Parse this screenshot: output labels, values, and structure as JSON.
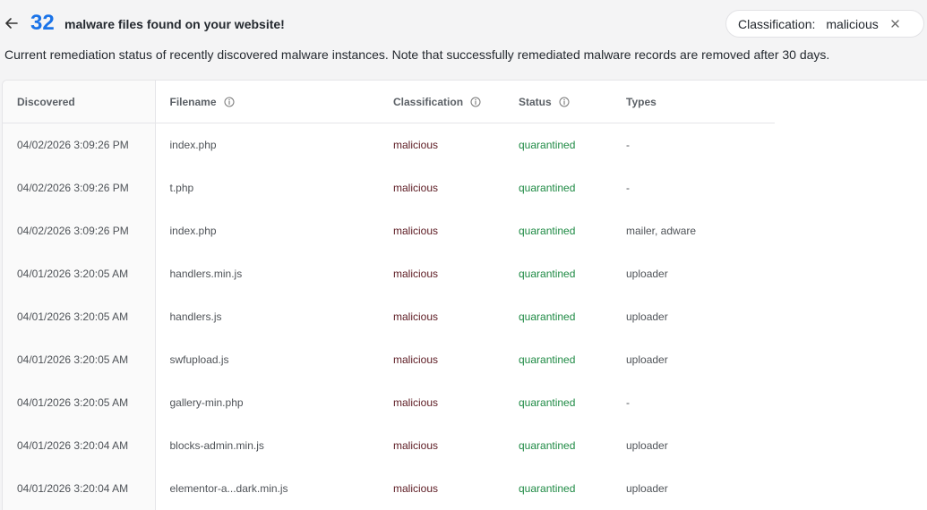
{
  "header": {
    "count": "32",
    "headline": "malware files found on your website!",
    "description": "Current remediation status of recently discovered malware instances. Note that successfully remediated malware records are removed after 30 days."
  },
  "filter_chip": {
    "key": "Classification:",
    "value": "malicious",
    "icon": "close-icon"
  },
  "table": {
    "columns": [
      "Discovered",
      "Filename",
      "Classification",
      "Status",
      "Types"
    ],
    "info_icons": [
      "Filename",
      "Classification",
      "Status"
    ],
    "rows": [
      {
        "discovered": "04/02/2026 3:09:26 PM",
        "filename": "index.php",
        "classification": "malicious",
        "status": "quarantined",
        "types": "-"
      },
      {
        "discovered": "04/02/2026 3:09:26 PM",
        "filename": "t.php",
        "classification": "malicious",
        "status": "quarantined",
        "types": "-"
      },
      {
        "discovered": "04/02/2026 3:09:26 PM",
        "filename": "index.php",
        "classification": "malicious",
        "status": "quarantined",
        "types": "mailer, adware"
      },
      {
        "discovered": "04/01/2026 3:20:05 AM",
        "filename": "handlers.min.js",
        "classification": "malicious",
        "status": "quarantined",
        "types": "uploader"
      },
      {
        "discovered": "04/01/2026 3:20:05 AM",
        "filename": "handlers.js",
        "classification": "malicious",
        "status": "quarantined",
        "types": "uploader"
      },
      {
        "discovered": "04/01/2026 3:20:05 AM",
        "filename": "swfupload.js",
        "classification": "malicious",
        "status": "quarantined",
        "types": "uploader"
      },
      {
        "discovered": "04/01/2026 3:20:05 AM",
        "filename": "gallery-min.php",
        "classification": "malicious",
        "status": "quarantined",
        "types": "-"
      },
      {
        "discovered": "04/01/2026 3:20:04 AM",
        "filename": "blocks-admin.min.js",
        "classification": "malicious",
        "status": "quarantined",
        "types": "uploader"
      },
      {
        "discovered": "04/01/2026 3:20:04 AM",
        "filename": "elementor-a...dark.min.js",
        "classification": "malicious",
        "status": "quarantined",
        "types": "uploader"
      }
    ]
  },
  "colors": {
    "count": "#1a73e8",
    "classification_text": "#5c1a22",
    "status_quarantined": "#1e8a44"
  }
}
